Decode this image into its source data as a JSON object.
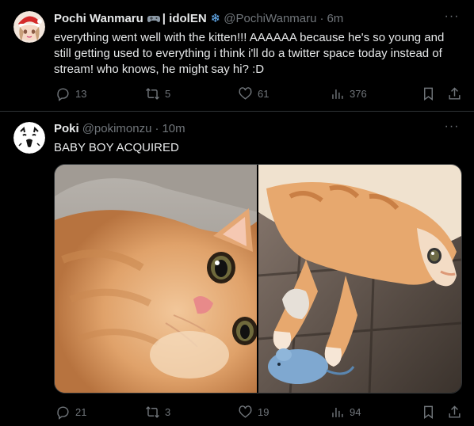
{
  "tweets": [
    {
      "name": "Pochi Wanmaru",
      "name_suffix": "| idolEN",
      "handle": "@PochiWanmaru",
      "time": "6m",
      "text": "everything went well with the kitten!!! AAAAAA because he's so young and still getting used to everything i think i'll do a twitter space today instead of stream! who knows, he might say hi? :D",
      "stats": {
        "replies": "13",
        "retweets": "5",
        "likes": "61",
        "views": "376"
      }
    },
    {
      "name": "Poki",
      "handle": "@pokimonzu",
      "time": "10m",
      "text": "BABY BOY ACQUIRED",
      "stats": {
        "replies": "21",
        "retweets": "3",
        "likes": "19",
        "views": "94"
      }
    }
  ],
  "separator": "·",
  "icons": {
    "reply": "reply-icon",
    "retweet": "retweet-icon",
    "like": "heart-icon",
    "views": "analytics-icon",
    "bookmark": "bookmark-icon",
    "share": "share-icon",
    "more": "more-icon"
  },
  "colors": {
    "background": "#000000",
    "text": "#e7e9ea",
    "muted": "#71767b",
    "border": "#2f3336"
  }
}
